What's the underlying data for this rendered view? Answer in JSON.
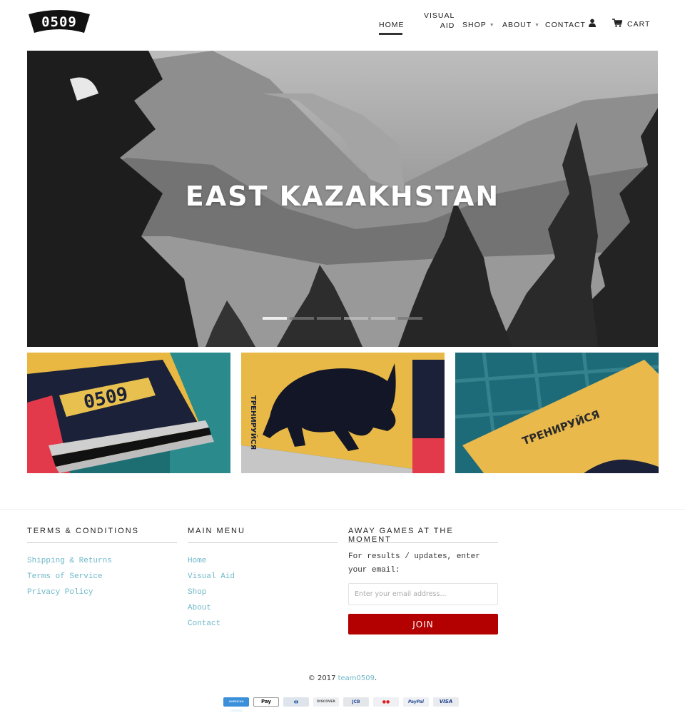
{
  "brand": {
    "logo_text": "0509"
  },
  "nav": {
    "items": [
      {
        "label": "HOME",
        "active": true
      },
      {
        "label_line1": "VISUAL",
        "label_line2": "AID"
      },
      {
        "label": "SHOP",
        "has_dropdown": true
      },
      {
        "label": "ABOUT",
        "has_dropdown": true
      },
      {
        "label": "CONTACT"
      }
    ],
    "account_icon": "user-icon",
    "cart_icon": "cart-icon",
    "cart_label": "CART",
    "caret": "▼"
  },
  "hero": {
    "title": "EAST KAZAKHSTAN",
    "slides_count": 6,
    "active_slide": 1
  },
  "products": [
    {
      "name": "0509 card deck",
      "printed_text": "0509"
    },
    {
      "name": "Rhino bear card",
      "printed_text": "ТРЕНИРУЙСЯ"
    },
    {
      "name": "Trenirujsya card",
      "printed_text": "ТРЕНИРУЙСЯ"
    }
  ],
  "footer": {
    "terms": {
      "heading": "TERMS & CONDITIONS",
      "links": [
        "Shipping & Returns",
        "Terms of Service",
        "Privacy Policy"
      ]
    },
    "menu": {
      "heading": "MAIN MENU",
      "links": [
        "Home",
        "Visual Aid",
        "Shop",
        "About",
        "Contact"
      ]
    },
    "newsletter": {
      "heading": "AWAY GAMES AT THE MOMENT",
      "description": "For results / updates, enter your email:",
      "email_placeholder": "Enter your email address...",
      "email_value": "",
      "button_label": "JOIN"
    },
    "copyright_prefix": "© 2017 ",
    "copyright_link": "team0509",
    "copyright_suffix": ".",
    "payment_methods": [
      "AMERICAN EXPRESS",
      " Pay",
      "◖◗",
      "DISCOVER",
      "JCB",
      "●●",
      "PayPal",
      "VISA"
    ]
  },
  "colors": {
    "link": "#6fb8c9",
    "button": "#b30000",
    "text": "#222222"
  }
}
